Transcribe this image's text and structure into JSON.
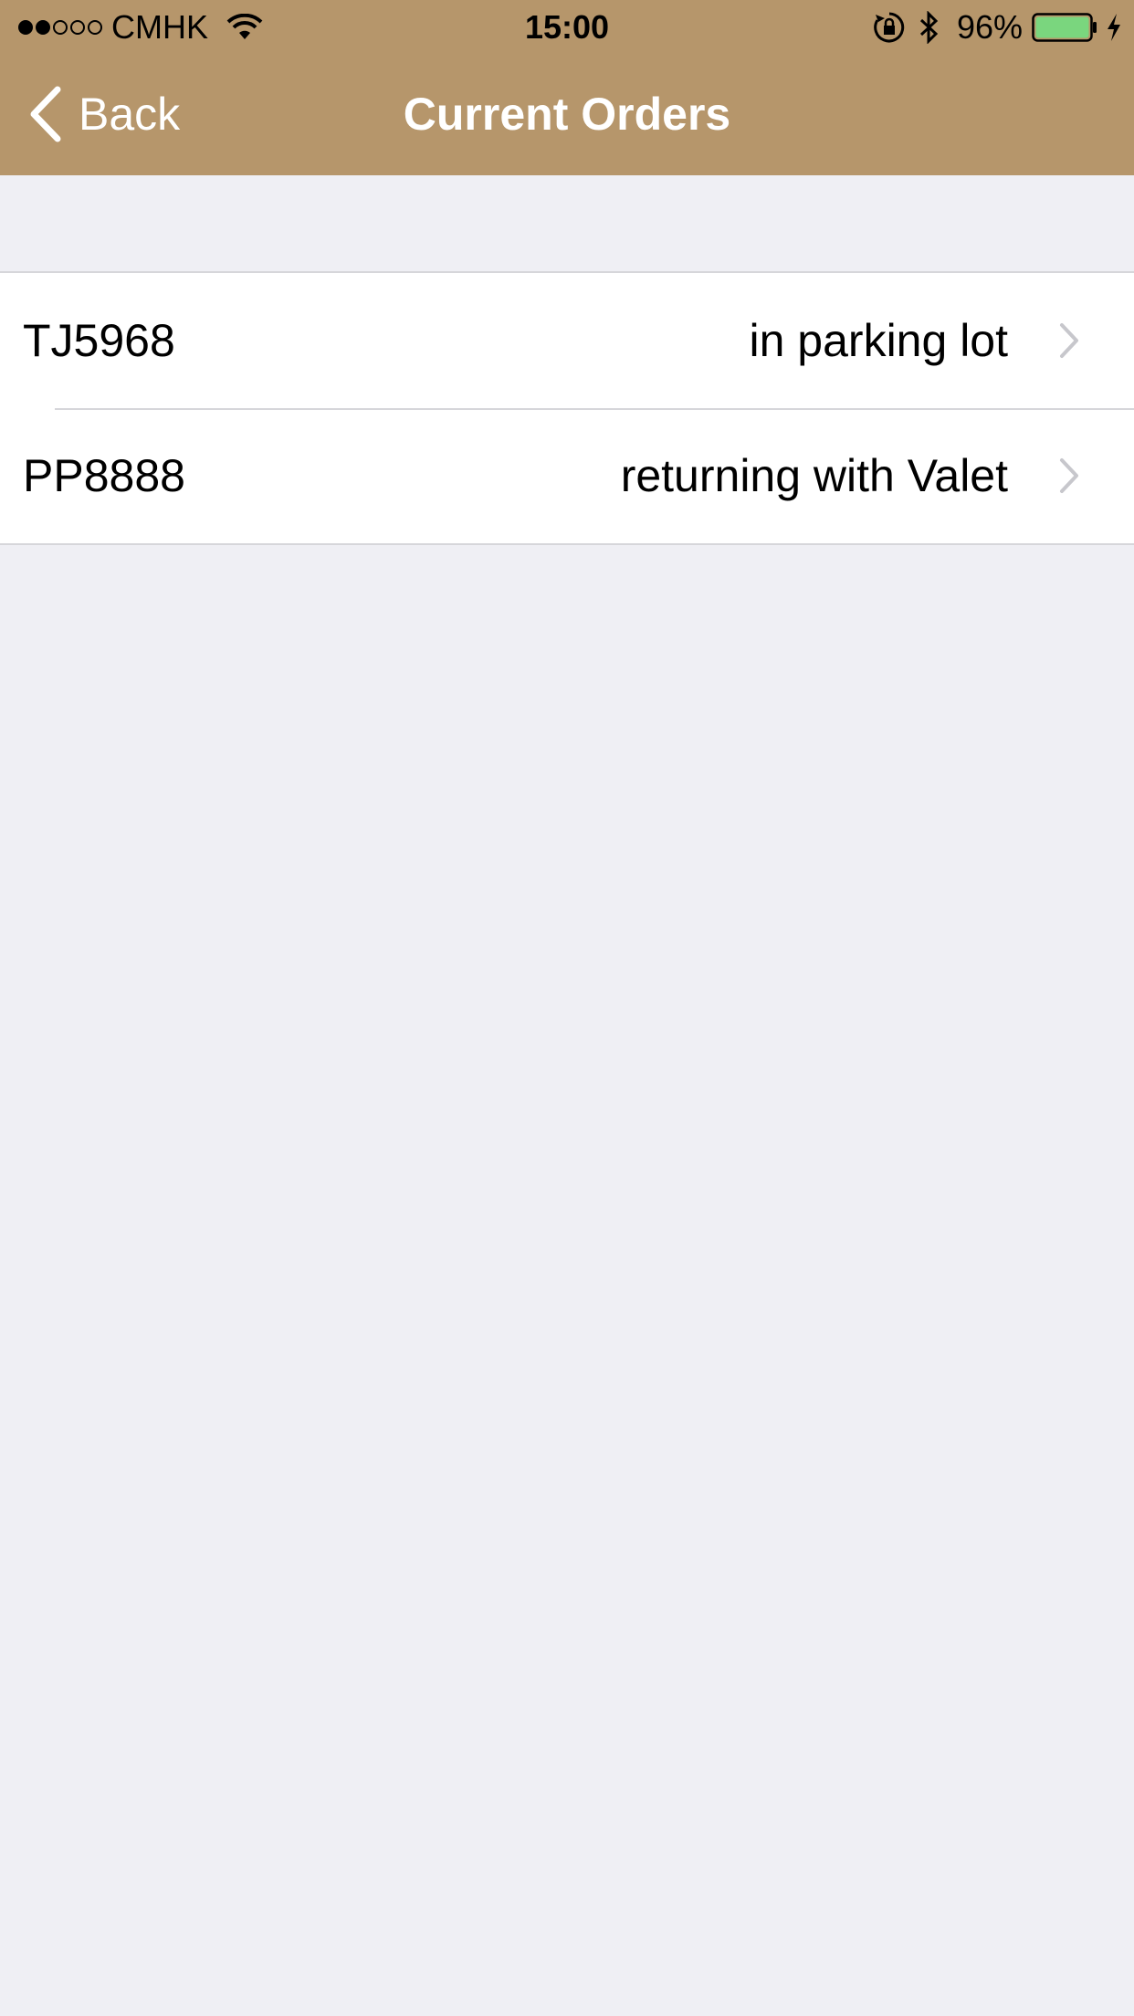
{
  "status_bar": {
    "carrier": "CMHK",
    "time": "15:00",
    "battery_percent": "96%",
    "signal_bars_filled": 2,
    "signal_bars_total": 5,
    "icons": [
      "wifi-icon",
      "rotation-lock-icon",
      "bluetooth-icon",
      "battery-icon",
      "charging-icon"
    ]
  },
  "nav": {
    "back_label": "Back",
    "title": "Current Orders"
  },
  "orders": [
    {
      "plate": "TJ5968",
      "status": "in parking lot"
    },
    {
      "plate": "PP8888",
      "status": "returning with Valet"
    }
  ],
  "colors": {
    "nav_background": "#b6966b",
    "page_background": "#efeff4",
    "battery_fill": "#7ad67e"
  }
}
